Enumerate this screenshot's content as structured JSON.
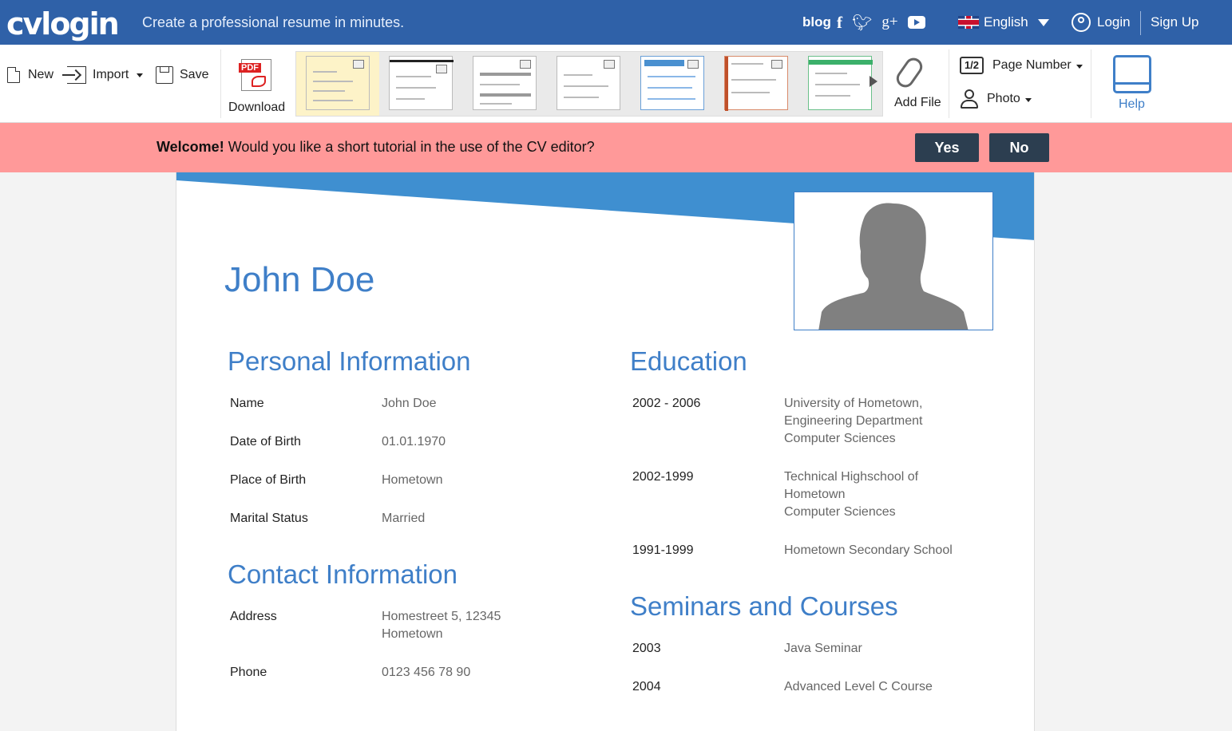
{
  "brand": {
    "logo": "cvlogin",
    "tagline": "Create a professional resume in minutes."
  },
  "topnav": {
    "blog": "blog",
    "social_icons": [
      "facebook-icon",
      "twitter-icon",
      "google-plus-icon",
      "youtube-icon"
    ],
    "language": "English",
    "login": "Login",
    "signup": "Sign Up"
  },
  "toolbar": {
    "new": "New",
    "import": "Import",
    "save": "Save",
    "download": "Download",
    "pdf_badge": "PDF",
    "add_file": "Add File",
    "page_number_badge": "1/2",
    "page_number": "Page Number",
    "photo": "Photo",
    "help": "Help"
  },
  "banner": {
    "welcome": "Welcome!",
    "question": " Would you like a short tutorial in the use of the CV editor?",
    "yes": "Yes",
    "no": "No"
  },
  "resume": {
    "name": "John Doe",
    "personal": {
      "title": "Personal Information",
      "rows": [
        {
          "label": "Name",
          "value": "John Doe"
        },
        {
          "label": "Date of Birth",
          "value": "01.01.1970"
        },
        {
          "label": "Place of Birth",
          "value": "Hometown"
        },
        {
          "label": "Marital Status",
          "value": "Married"
        }
      ]
    },
    "contact": {
      "title": "Contact Information",
      "rows": [
        {
          "label": "Address",
          "value_lines": [
            "Homestreet 5, 12345",
            "Hometown"
          ]
        },
        {
          "label": "Phone",
          "value_lines": [
            "0123 456 78 90"
          ]
        }
      ]
    },
    "education": {
      "title": "Education",
      "rows": [
        {
          "label": "2002 - 2006",
          "value_lines": [
            "University of Hometown,",
            "Engineering Department",
            "Computer Sciences"
          ]
        },
        {
          "label": "2002-1999",
          "value_lines": [
            "Technical Highschool of",
            "Hometown",
            "Computer Sciences"
          ]
        },
        {
          "label": "1991-1999",
          "value_lines": [
            "Hometown Secondary School"
          ]
        }
      ]
    },
    "seminars": {
      "title": "Seminars and Courses",
      "rows": [
        {
          "label": "2003",
          "value": "Java Seminar"
        },
        {
          "label": "2004",
          "value": "Advanced Level C Course"
        }
      ]
    }
  },
  "colors": {
    "brand_blue": "#2f61a8",
    "accent_blue": "#3f7fc8",
    "banner_pink": "#ff9999",
    "button_dark": "#2c3e50"
  }
}
